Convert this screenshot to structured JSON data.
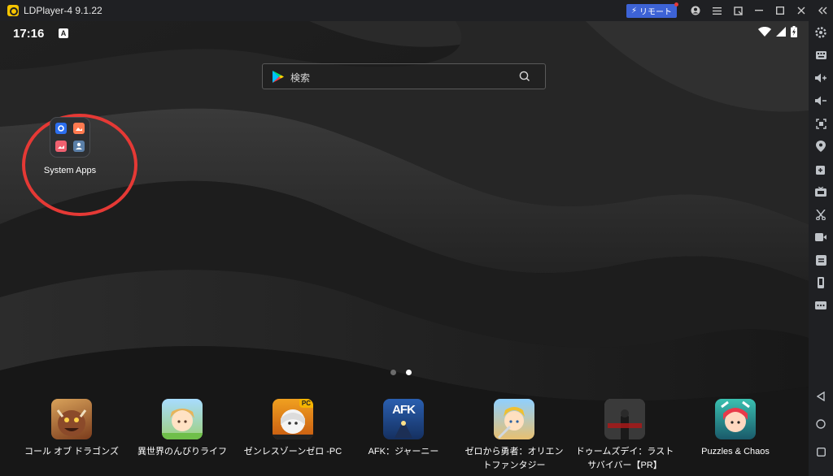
{
  "window": {
    "app_title": "LDPlayer-4 9.1.22",
    "remote_label": "リモート",
    "controls": [
      "account-icon",
      "menu-icon",
      "resize-icon",
      "minimize-icon",
      "maximize-icon",
      "close-icon",
      "collapse-sidebar-icon"
    ]
  },
  "status_bar": {
    "time": "17:16",
    "notification_icon": "A"
  },
  "search": {
    "placeholder": "検索"
  },
  "folder": {
    "label": "System Apps",
    "highlight_color": "#e53935"
  },
  "page_indicator": {
    "count": 2,
    "active_index": 1
  },
  "dock": {
    "apps": [
      {
        "label": "コール オブ ドラゴンズ",
        "icon": "call-of-dragons-icon"
      },
      {
        "label": "異世界のんびりライフ",
        "icon": "isekai-nonbiri-life-icon"
      },
      {
        "label": "ゼンレスゾーンゼロ -PC",
        "icon": "zenless-zone-zero-icon",
        "badge": "PC"
      },
      {
        "label": "AFK：ジャーニー",
        "icon": "afk-journey-icon",
        "logo": "AFK"
      },
      {
        "label": "ゼロから勇者：オリエン",
        "label2": "トファンタジー",
        "icon": "zero-kara-yusha-icon"
      },
      {
        "label": "ドゥームズデイ：ラスト",
        "label2": "サバイバー【PR】",
        "icon": "doomsday-last-survivors-icon"
      },
      {
        "label": "Puzzles & Chaos",
        "icon": "puzzles-and-chaos-icon"
      }
    ]
  },
  "sidebar": {
    "icons": [
      "settings-icon",
      "keyboard-mapping-icon",
      "volume-up-icon",
      "volume-down-icon",
      "screenshot-icon",
      "location-icon",
      "add-apk-icon",
      "operation-recorder-icon",
      "scissors-icon",
      "record-video-icon",
      "sync-icon",
      "shake-icon",
      "more-icon",
      "back-icon",
      "home-icon",
      "recents-icon"
    ]
  },
  "colors": {
    "accent": "#3d63d6",
    "titlebar": "#1f2023"
  }
}
